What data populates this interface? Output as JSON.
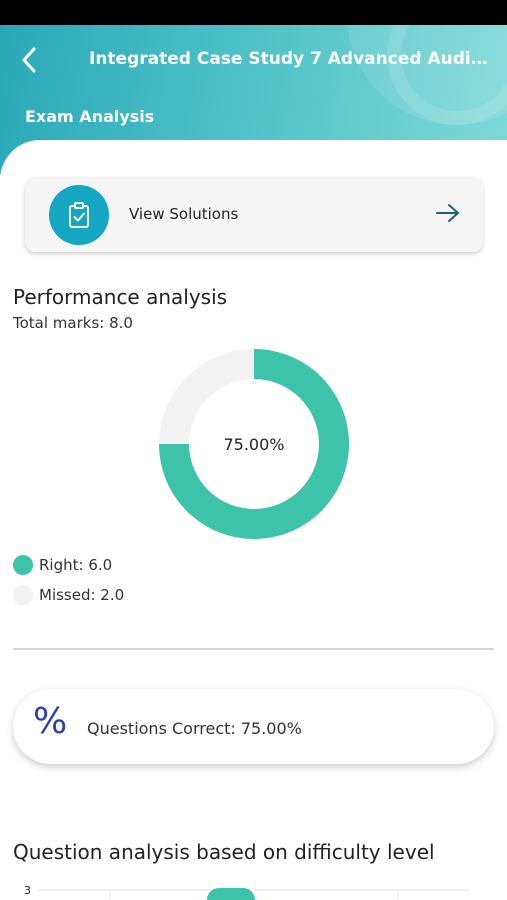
{
  "header": {
    "title": "Integrated Case Study 7 Advanced Auditing ...",
    "subtitle": "Exam Analysis"
  },
  "view_solutions": {
    "label": "View Solutions",
    "icon": "clipboard-check-icon"
  },
  "performance": {
    "title": "Performance analysis",
    "total_marks": "Total marks: 8.0",
    "center_text": "75.00%",
    "legend": [
      {
        "label": "Right: 6.0",
        "color": "#3cc3aa"
      },
      {
        "label": "Missed: 2.0",
        "color": "#f2f2f2"
      }
    ]
  },
  "chart_data": {
    "type": "pie",
    "categories": [
      "Right",
      "Missed"
    ],
    "values": [
      6.0,
      2.0
    ],
    "colors": [
      "#3cc3aa",
      "#f2f2f2"
    ],
    "center_label": "75.00%"
  },
  "questions_correct": {
    "icon": "%",
    "label": "Questions Correct: 75.00%"
  },
  "difficulty": {
    "title": "Question analysis based on difficulty level",
    "y_tick": "3"
  },
  "colors": {
    "accent": "#13a7c1",
    "header_start": "#2aa8b8",
    "header_end": "#7fd9d8",
    "percent_blue": "#2b3fb0"
  }
}
